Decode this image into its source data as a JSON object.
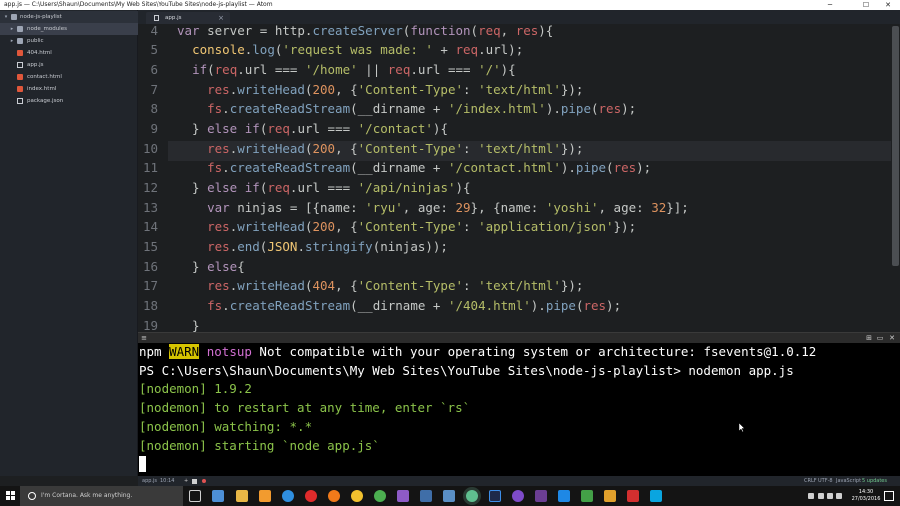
{
  "window": {
    "title": "app.js — C:\\Users\\Shaun\\Documents\\My Web Sites\\YouTube Sites\\node-js-playlist — Atom"
  },
  "sidebar": {
    "root": "node-js-playlist",
    "items": [
      {
        "label": "node_modules",
        "type": "folder",
        "icon": "folder-icon"
      },
      {
        "label": "public",
        "type": "folder",
        "icon": "folder-icon"
      },
      {
        "label": "404.html",
        "type": "file",
        "icon": "html-file-icon"
      },
      {
        "label": "app.js",
        "type": "file",
        "icon": "js-file-icon"
      },
      {
        "label": "contact.html",
        "type": "file",
        "icon": "html-file-icon"
      },
      {
        "label": "index.html",
        "type": "file",
        "icon": "html-file-icon"
      },
      {
        "label": "package.json",
        "type": "file",
        "icon": "json-file-icon"
      }
    ]
  },
  "tab": {
    "label": "app.js",
    "close": "×"
  },
  "editor": {
    "line_numbers": [
      "4",
      "5",
      "6",
      "7",
      "8",
      "9",
      "10",
      "11",
      "12",
      "13",
      "14",
      "15",
      "16",
      "17",
      "18",
      "19"
    ],
    "lines": [
      "var server = http.createServer(function(req, res){",
      "  console.log('request was made: ' + req.url);",
      "  if(req.url === '/home' || req.url === '/'){",
      "    res.writeHead(200, {'Content-Type': 'text/html'});",
      "    fs.createReadStream(__dirname + '/index.html').pipe(res);",
      "  } else if(req.url === '/contact'){",
      "    res.writeHead(200, {'Content-Type': 'text/html'});",
      "    fs.createReadStream(__dirname + '/contact.html').pipe(res);",
      "  } else if(req.url === '/api/ninjas'){",
      "    var ninjas = [{name: 'ryu', age: 29}, {name: 'yoshi', age: 32}];",
      "    res.writeHead(200, {'Content-Type': 'application/json'});",
      "    res.end(JSON.stringify(ninjas));",
      "  } else{",
      "    res.writeHead(404, {'Content-Type': 'text/html'});",
      "    fs.createReadStream(__dirname + '/404.html').pipe(res);",
      "  }"
    ],
    "highlighted_line": "10"
  },
  "terminal": {
    "warn_prefix": "npm ",
    "warn_badge": "WARN",
    "warn_code": "notsup",
    "warn_text": " Not compatible with your operating system or architecture: fsevents@1.0.12",
    "prompt_line": "PS C:\\Users\\Shaun\\Documents\\My Web Sites\\YouTube Sites\\node-js-playlist> nodemon app.js",
    "nodemon_lines": [
      "[nodemon] 1.9.2",
      "[nodemon] to restart at any time, enter `rs`",
      "[nodemon] watching: *.*",
      "[nodemon] starting `node app.js`"
    ]
  },
  "statusbar": {
    "file": "app.js",
    "position": "10:14",
    "line_ending": "CRLF",
    "encoding": "UTF-8",
    "grammar": "JavaScript",
    "updates": "5 updates"
  },
  "taskbar": {
    "cortana_placeholder": "I'm Cortana. Ask me anything.",
    "time": "14:30",
    "date": "27/03/2016"
  },
  "colors": {
    "editor_bg": "#1d1f21",
    "keyword": "#b294bb",
    "function": "#81a2be",
    "string": "#b5bd68",
    "number": "#de935f",
    "terminal_green": "#8bc34a",
    "warn_bg": "#d6c400"
  }
}
